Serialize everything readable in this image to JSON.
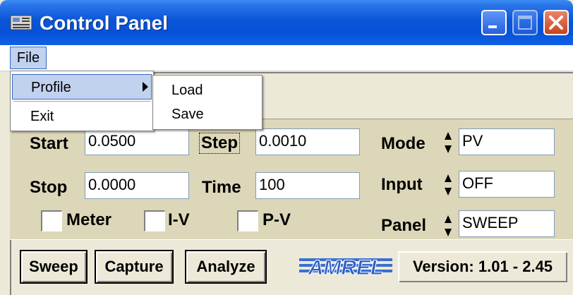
{
  "window": {
    "title": "Control Panel"
  },
  "menubar": {
    "file_label": "File"
  },
  "file_menu": {
    "items": [
      {
        "label": "Profile"
      },
      {
        "label": "Exit"
      }
    ],
    "profile_submenu": [
      {
        "label": "Load"
      },
      {
        "label": "Save"
      }
    ]
  },
  "params": {
    "start_label": "Start",
    "start_value": "0.0500",
    "step_label": "Step",
    "step_value": "0.0010",
    "stop_label": "Stop",
    "stop_value": "0.0000",
    "time_label": "Time",
    "time_value": "100",
    "mode_label": "Mode",
    "mode_value": "PV",
    "input_label": "Input",
    "input_value": "OFF",
    "panel_label": "Panel",
    "panel_value": "SWEEP"
  },
  "checks": {
    "meter_label": "Meter",
    "iv_label": "I-V",
    "pv_label": "P-V"
  },
  "buttons": {
    "sweep": "Sweep",
    "capture": "Capture",
    "analyze": "Analyze"
  },
  "logo": {
    "text": "AMREL"
  },
  "version": "Version: 1.01 - 2.45",
  "colors": {
    "title_bar": "#0a55d8",
    "menu_highlight": "#c1d2ee",
    "group_bg": "#dcd7b8",
    "logo_blue": "#3b6fd1"
  }
}
